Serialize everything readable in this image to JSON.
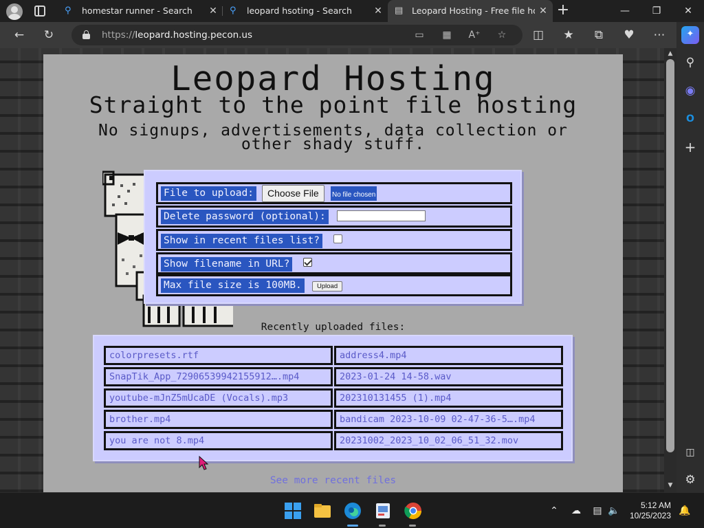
{
  "browser": {
    "tabs": [
      {
        "title": "homestar runner - Search",
        "icon": "search-icon"
      },
      {
        "title": "leopard hsoting - Search",
        "icon": "search-icon"
      },
      {
        "title": "Leopard Hosting - Free file hosti",
        "icon": "page-icon",
        "active": true
      }
    ],
    "window_controls": {
      "minimize": "—",
      "restore": "❐",
      "close": "✕"
    },
    "url": {
      "protocol": "https://",
      "host": "leopard.hosting.pecon.us"
    }
  },
  "page": {
    "title": "Leopard Hosting",
    "subtitle": "Straight to the point file hosting",
    "tagline": "No signups, advertisements, data collection or other shady stuff.",
    "form": {
      "file_label": "File to upload:",
      "choose_file": "Choose File",
      "no_file": "No file chosen",
      "password_label": "Delete password (optional):",
      "password_value": "",
      "recent_label": "Show in recent files list?",
      "recent_checked": false,
      "filename_label": "Show filename in URL?",
      "filename_checked": true,
      "max_size_label": "Max file size is 100MB.",
      "upload_button": "Upload"
    },
    "recent_title": "Recently uploaded files:",
    "recent_files": [
      [
        "colorpresets.rtf",
        "address4.mp4"
      ],
      [
        "SnapTik_App_72906539942155912….mp4",
        "2023-01-24 14-58.wav"
      ],
      [
        "youtube-mJnZ5mUcaDE (Vocals).mp3",
        "202310131455 (1).mp4"
      ],
      [
        "brother.mp4",
        "bandicam 2023-10-09 02-47-36-5….mp4"
      ],
      [
        "you are not 8.mp4",
        "20231002_2023_10_02_06_51_32.mov"
      ]
    ],
    "see_more": "See more recent files"
  },
  "taskbar": {
    "time": "5:12 AM",
    "date": "10/25/2023"
  },
  "colors": {
    "page_bg": "#a9a9a9",
    "panel_bg": "#ccccff",
    "label_bg": "#2a56c0",
    "link": "#5a5ac8"
  }
}
